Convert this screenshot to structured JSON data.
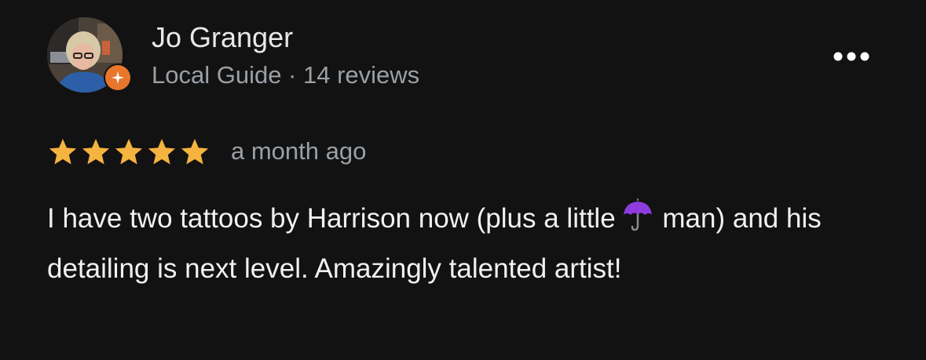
{
  "review": {
    "author_name": "Jo Granger",
    "author_meta": "Local Guide · 14 reviews",
    "rating": 5,
    "rating_max": 5,
    "date": "a month ago",
    "text_part1": "I have two tattoos by Harrison now (plus a little",
    "emoji": "☂️",
    "text_part2": " man) and his detailing is next level. Amazingly talented artist!"
  },
  "colors": {
    "background": "#121212",
    "star": "#f4b43f",
    "guide_badge": "#e8762c",
    "secondary_text": "#9aa0a6",
    "umbrella": "#8e3ce0"
  },
  "icons": {
    "avatar": "user-avatar-photo",
    "badge": "local-guide-badge-icon",
    "more": "more-options-icon",
    "star": "star-filled-icon",
    "emoji": "umbrella-emoji-icon"
  }
}
